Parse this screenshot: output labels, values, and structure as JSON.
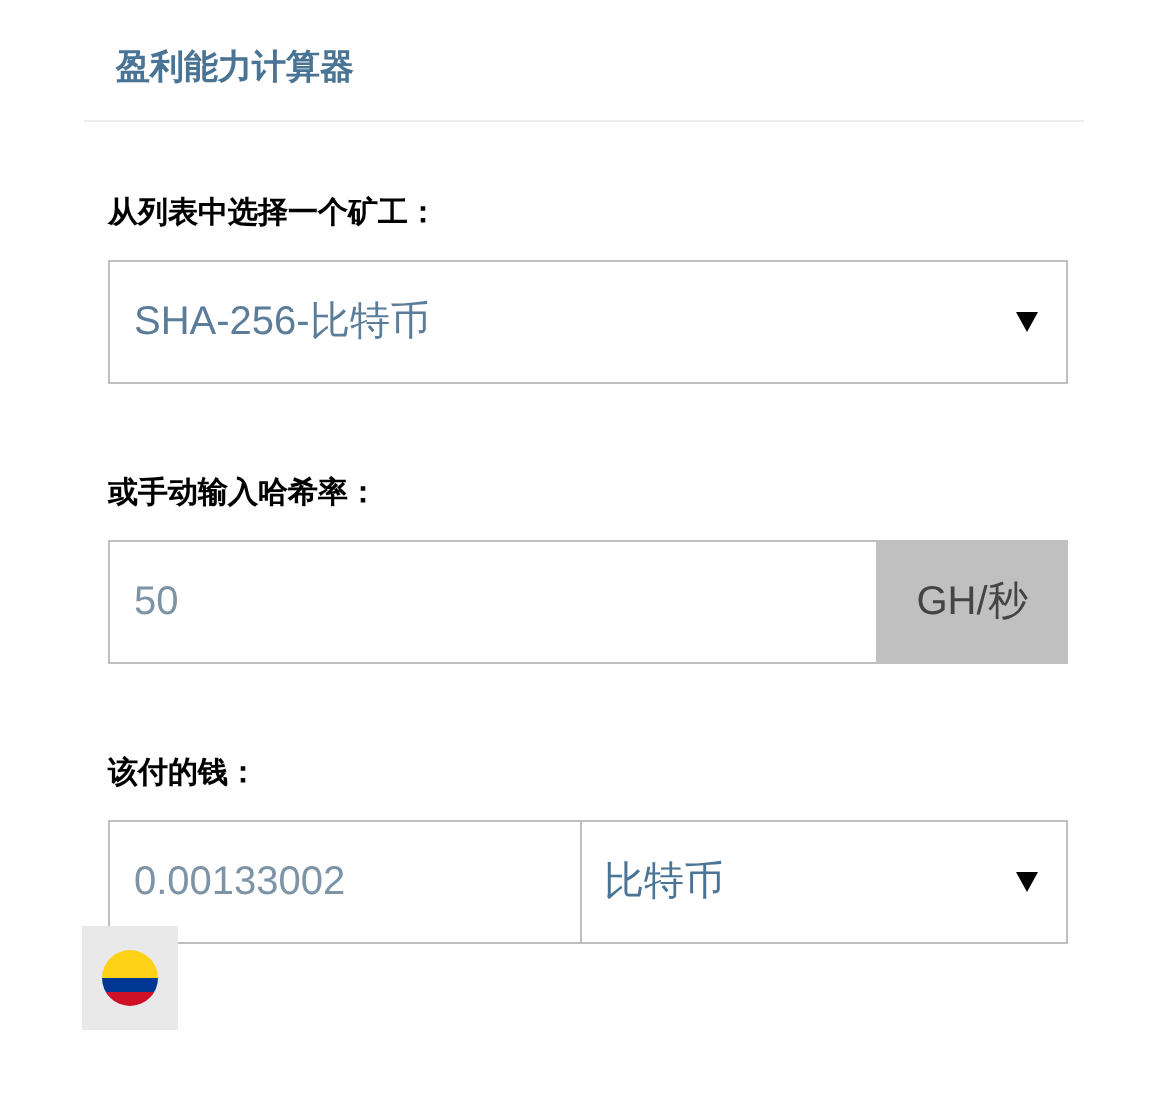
{
  "title": "盈利能力计算器",
  "miner": {
    "label": "从列表中选择一个矿工：",
    "value": "SHA-256-比特币"
  },
  "hashrate": {
    "label": "或手动输入哈希率：",
    "value": "50",
    "unit": "GH/秒"
  },
  "payout": {
    "label": "该付的钱：",
    "value": "0.00133002",
    "currency": "比特币"
  },
  "language_flag": {
    "kind": "flag"
  }
}
